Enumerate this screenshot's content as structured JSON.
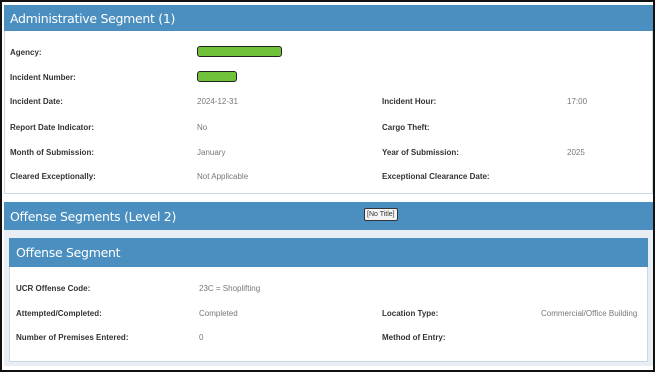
{
  "admin": {
    "title": "Administrative Segment (1)",
    "agency_label": "Agency:",
    "incident_number_label": "Incident Number:",
    "incident_date_label": "Incident Date:",
    "incident_date_value": "2024-12-31",
    "incident_hour_label": "Incident Hour:",
    "incident_hour_value": "17:00",
    "report_date_indicator_label": "Report Date Indicator:",
    "report_date_indicator_value": "No",
    "cargo_theft_label": "Cargo Theft:",
    "month_submission_label": "Month of Submission:",
    "month_submission_value": "January",
    "year_submission_label": "Year of Submission:",
    "year_submission_value": "2025",
    "cleared_exceptionally_label": "Cleared Exceptionally:",
    "cleared_exceptionally_value": "Not Applicable",
    "exceptional_clearance_date_label": "Exceptional Clearance Date:"
  },
  "offense_segments": {
    "title": "Offense Segments (Level 2)",
    "tooltip": "[No Title]"
  },
  "offense": {
    "title": "Offense Segment",
    "ucr_code_label": "UCR Offense Code:",
    "ucr_code_value": "23C = Shoplifting",
    "attempted_label": "Attempted/Completed:",
    "attempted_value": "Completed",
    "location_type_label": "Location Type:",
    "location_type_value": "Commercial/Office Building",
    "premises_label": "Number of Premises Entered:",
    "premises_value": "0",
    "method_entry_label": "Method of Entry:"
  },
  "colors": {
    "header_blue": "#4a8fc0",
    "redaction_green": "#6fc23a"
  }
}
